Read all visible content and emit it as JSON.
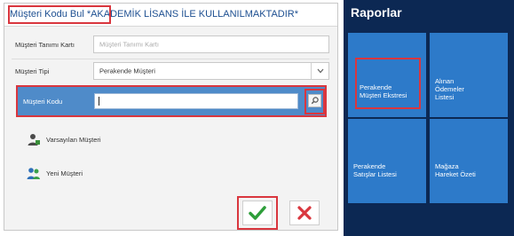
{
  "dialog": {
    "title": "Müşteri Kodu Bul *AKADEMİK LİSANS İLE KULLANILMAKTADIR*",
    "tanim_label": "Müşteri Tanımı Kartı",
    "tanim_placeholder": "Müşteri Tanımı Kartı",
    "tipi_label": "Müşteri Tipi",
    "tipi_value": "Perakende Müşteri",
    "kodu_label": "Müşteri Kodu",
    "kodu_value": "",
    "action_existing": "Varsayılan Müşteri",
    "action_new": "Yeni Müşteri"
  },
  "panel": {
    "title": "Raporlar",
    "tiles": [
      {
        "line1": "Perakende",
        "line2": "Müşteri Ekstresi"
      },
      {
        "line1": "Alınan",
        "line2": "Ödemeler",
        "line3": "Listesi"
      },
      {
        "line1": "Perakende",
        "line2": "Satışlar Listesi"
      },
      {
        "line1": "Mağaza",
        "line2": "Hareket Özeti"
      }
    ]
  },
  "colors": {
    "accent_red": "#d9363e",
    "tile_blue": "#2d7ac9",
    "panel_navy": "#0c2853",
    "ok_green": "#2e9e3a"
  },
  "icons": [
    "search-icon",
    "dropdown-chevron-icon",
    "existing-customer-icon",
    "new-customer-icon",
    "check-icon",
    "close-icon"
  ]
}
